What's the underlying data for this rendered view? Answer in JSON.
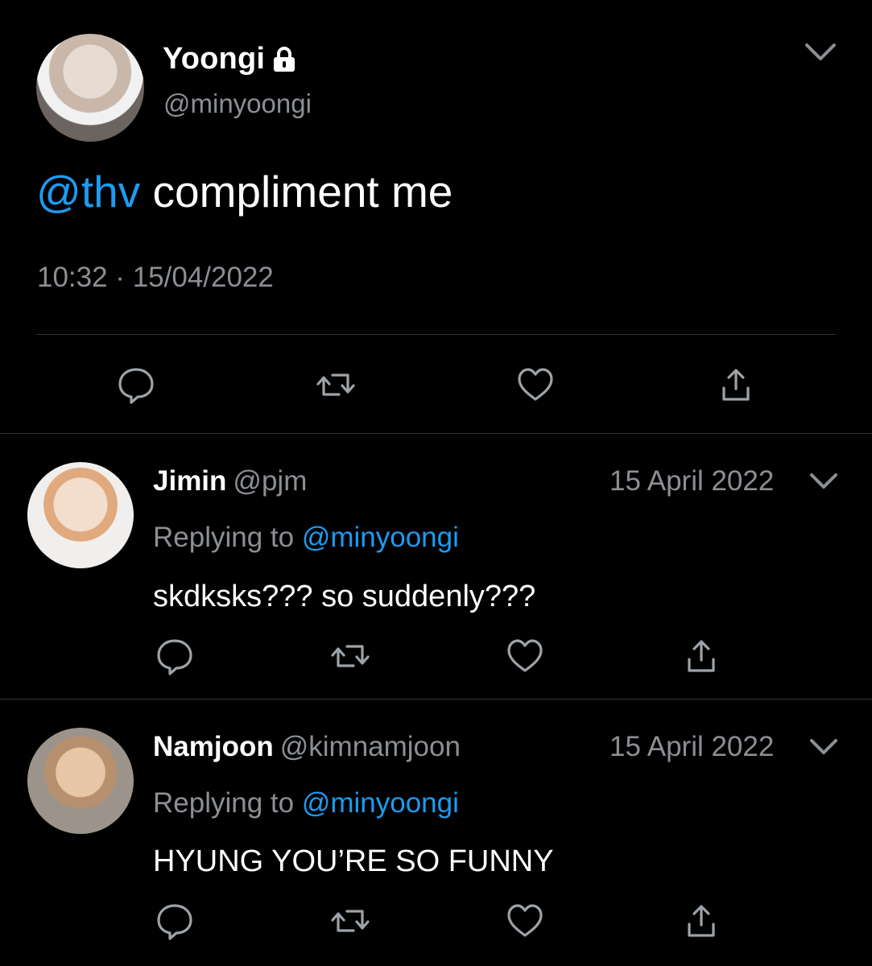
{
  "main_tweet": {
    "author_name": "Yoongi",
    "author_handle": "@minyoongi",
    "mention": "@thv",
    "text": " compliment me",
    "timestamp": "10:32 · 15/04/2022",
    "protected_icon": "lock-icon",
    "menu_icon": "chevron-down-icon"
  },
  "actions": [
    "reply-icon",
    "retweet-icon",
    "like-icon",
    "share-icon"
  ],
  "replies": [
    {
      "author_name": "Jimin",
      "author_handle": "@pjm",
      "date": "15 April 2022",
      "replying_prefix": "Replying to ",
      "replying_to": "@minyoongi",
      "text": "skdksks??? so suddenly???"
    },
    {
      "author_name": "Namjoon",
      "author_handle": "@kimnamjoon",
      "date": "15 April 2022",
      "replying_prefix": "Replying to ",
      "replying_to": "@minyoongi",
      "text": "HYUNG YOU’RE SO FUNNY"
    }
  ],
  "colors": {
    "background": "#000000",
    "text": "#ffffff",
    "secondary": "#8b8f94",
    "accent": "#1d9bf0",
    "divider": "#333639"
  }
}
